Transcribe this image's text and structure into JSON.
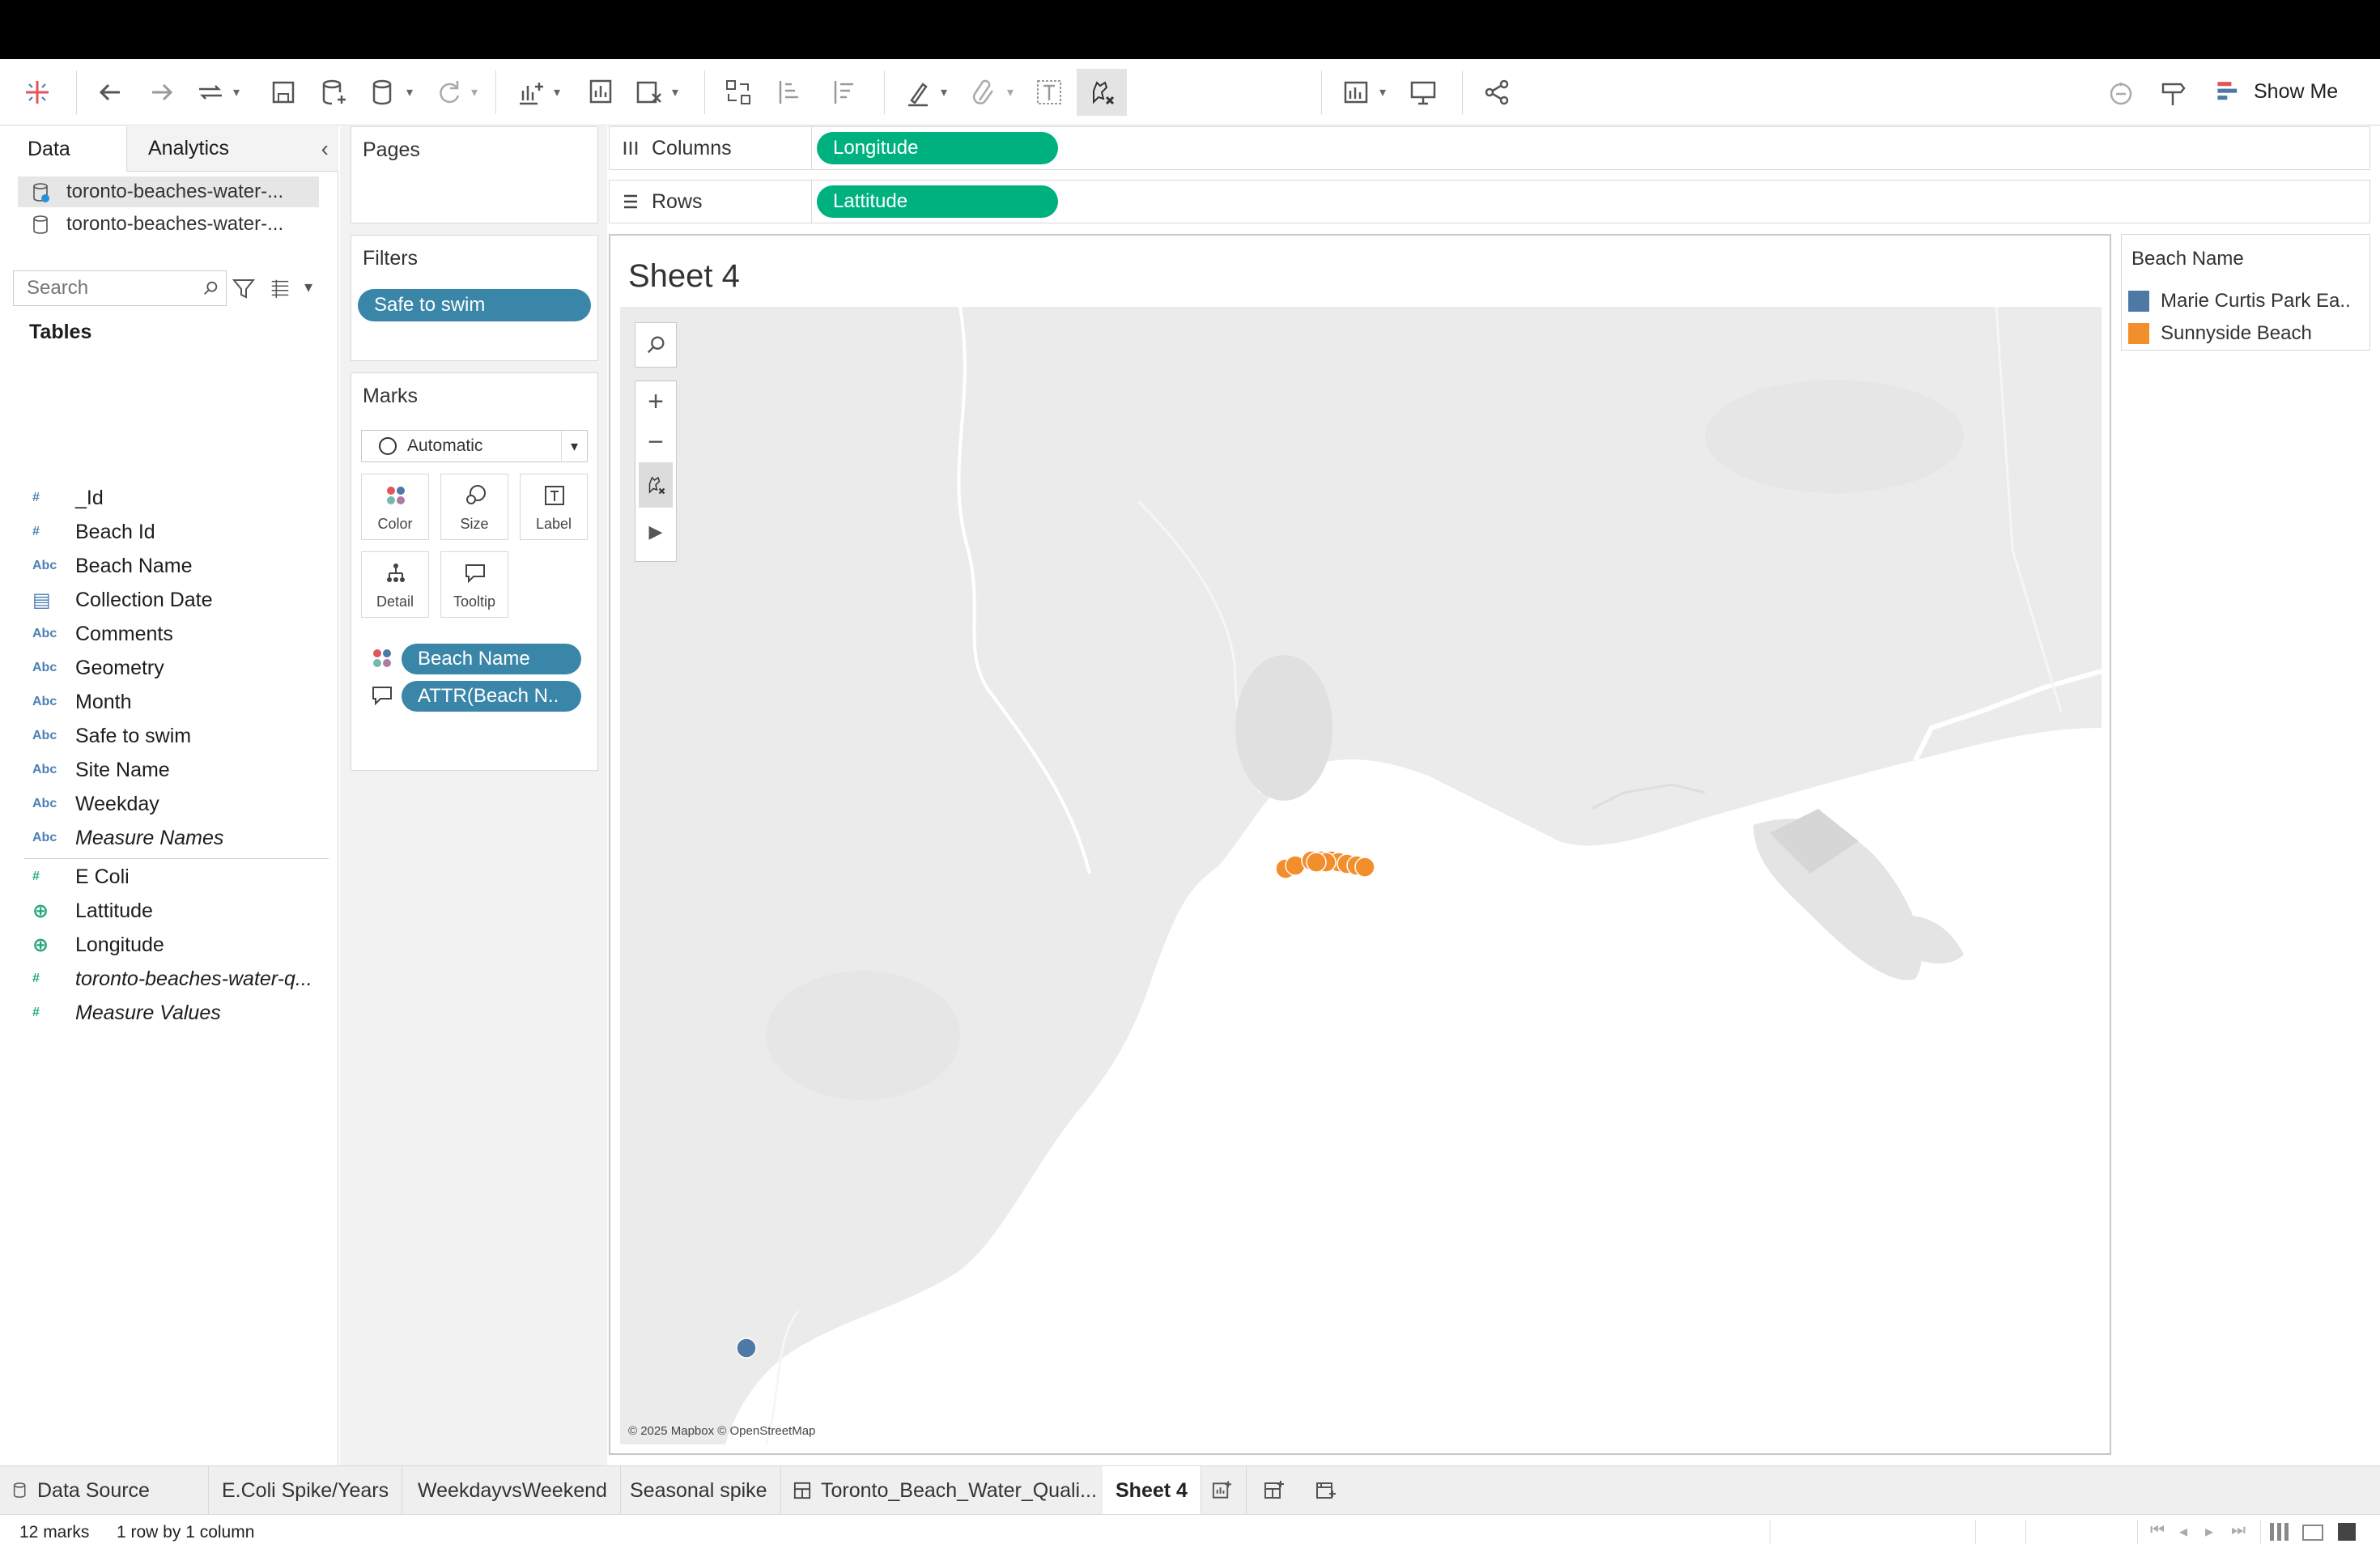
{
  "toolbar": {
    "show_me": "Show Me"
  },
  "data_pane": {
    "tab_data": "Data",
    "tab_analytics": "Analytics",
    "datasources": [
      "toronto-beaches-water-...",
      "toronto-beaches-water-..."
    ],
    "search_placeholder": "Search",
    "tables_label": "Tables",
    "fields": [
      {
        "type": "#",
        "name": "_Id"
      },
      {
        "type": "#",
        "name": "Beach Id"
      },
      {
        "type": "Abc",
        "name": "Beach Name"
      },
      {
        "type": "date",
        "name": "Collection Date"
      },
      {
        "type": "Abc",
        "name": "Comments"
      },
      {
        "type": "Abc",
        "name": "Geometry"
      },
      {
        "type": "Abc",
        "name": "Month"
      },
      {
        "type": "Abc",
        "name": "Safe to swim"
      },
      {
        "type": "Abc",
        "name": "Site Name"
      },
      {
        "type": "Abc",
        "name": "Weekday"
      },
      {
        "type": "Abc",
        "name": "Measure Names"
      }
    ],
    "measures": [
      {
        "type": "#",
        "name": "E Coli"
      },
      {
        "type": "geo",
        "name": "Lattitude"
      },
      {
        "type": "geo",
        "name": "Longitude"
      },
      {
        "type": "#",
        "name": "toronto-beaches-water-q..."
      },
      {
        "type": "#",
        "name": "Measure Values"
      }
    ]
  },
  "cards": {
    "pages": "Pages",
    "filters": "Filters",
    "filter_pill": "Safe to swim",
    "marks": "Marks",
    "mark_type": "Automatic",
    "mark_buttons": [
      "Color",
      "Size",
      "Label",
      "Detail",
      "Tooltip"
    ],
    "mark_pills": [
      "Beach Name",
      "ATTR(Beach N.."
    ]
  },
  "shelves": {
    "columns_label": "Columns",
    "columns_pill": "Longitude",
    "rows_label": "Rows",
    "rows_pill": "Lattitude"
  },
  "sheet": {
    "title": "Sheet 4",
    "attribution": "© 2025 Mapbox © OpenStreetMap"
  },
  "legend": {
    "title": "Beach Name",
    "items": [
      {
        "label": "Marie Curtis Park Ea..",
        "color": "#4e79a7"
      },
      {
        "label": "Sunnyside Beach",
        "color": "#f28e2b"
      }
    ]
  },
  "tabs": {
    "data_source": "Data Source",
    "sheets": [
      "E.Coli Spike/Years",
      "WeekdayvsWeekend",
      "Seasonal spike",
      "Toronto_Beach_Water_Quali...",
      "Sheet 4"
    ],
    "active": "Sheet 4"
  },
  "status": {
    "marks": "12 marks",
    "dims": "1 row by 1 column"
  },
  "colors": {
    "accent_green": "#00b180",
    "accent_blue": "#3a86a8",
    "marie": "#4e79a7",
    "sunnyside": "#f28e2b"
  }
}
